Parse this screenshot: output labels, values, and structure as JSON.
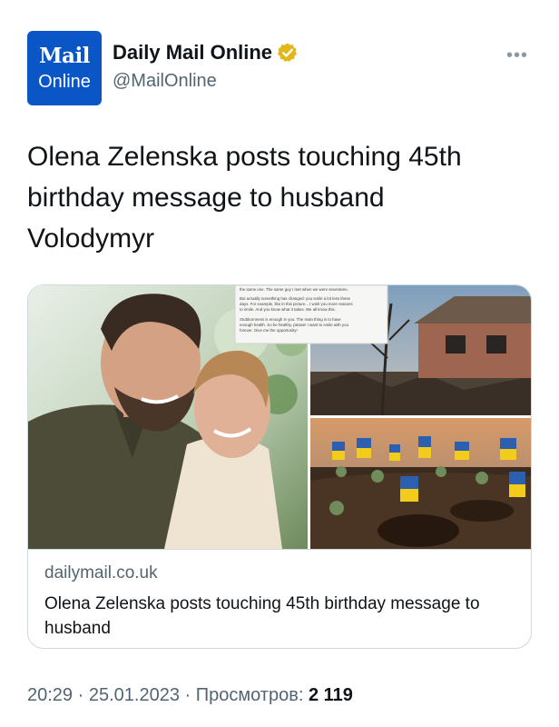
{
  "account": {
    "avatar_line1": "Mail",
    "avatar_line2": "Online",
    "display_name": "Daily Mail Online",
    "handle": "@MailOnline",
    "more_label": "•••"
  },
  "tweet": {
    "text": "Olena Zelenska posts touching 45th birthday message to husband Volodymyr"
  },
  "card": {
    "domain": "dailymail.co.uk",
    "title": "Olena Zelenska posts touching 45th birthday message to husband",
    "screenshot_text": [
      "the same one. The same guy I met when we were seventeen.",
      "But actually something has changed: you smile a lot less these",
      "days. For example, like in this picture... I wish you more reasons",
      "to smile. And you know what it takes. We all know this.",
      "Stubbornness is enough in you. The main thing is to have",
      "enough health. So be healthy, please! I want to smile with you",
      "forever. Give me the opportunity!"
    ]
  },
  "meta": {
    "time": "20:29",
    "sep1": " · ",
    "date": "25.01.2023",
    "sep2": " · ",
    "views_label": "Просмотров:",
    "views_count": "2 119"
  },
  "colors": {
    "avatar_bg": "#0b56c7",
    "verified_badge": "#e2b719",
    "secondary_text": "#536471",
    "border": "#cfd9de"
  },
  "icons": {
    "verified": "verified-badge-icon",
    "more": "more-icon"
  }
}
